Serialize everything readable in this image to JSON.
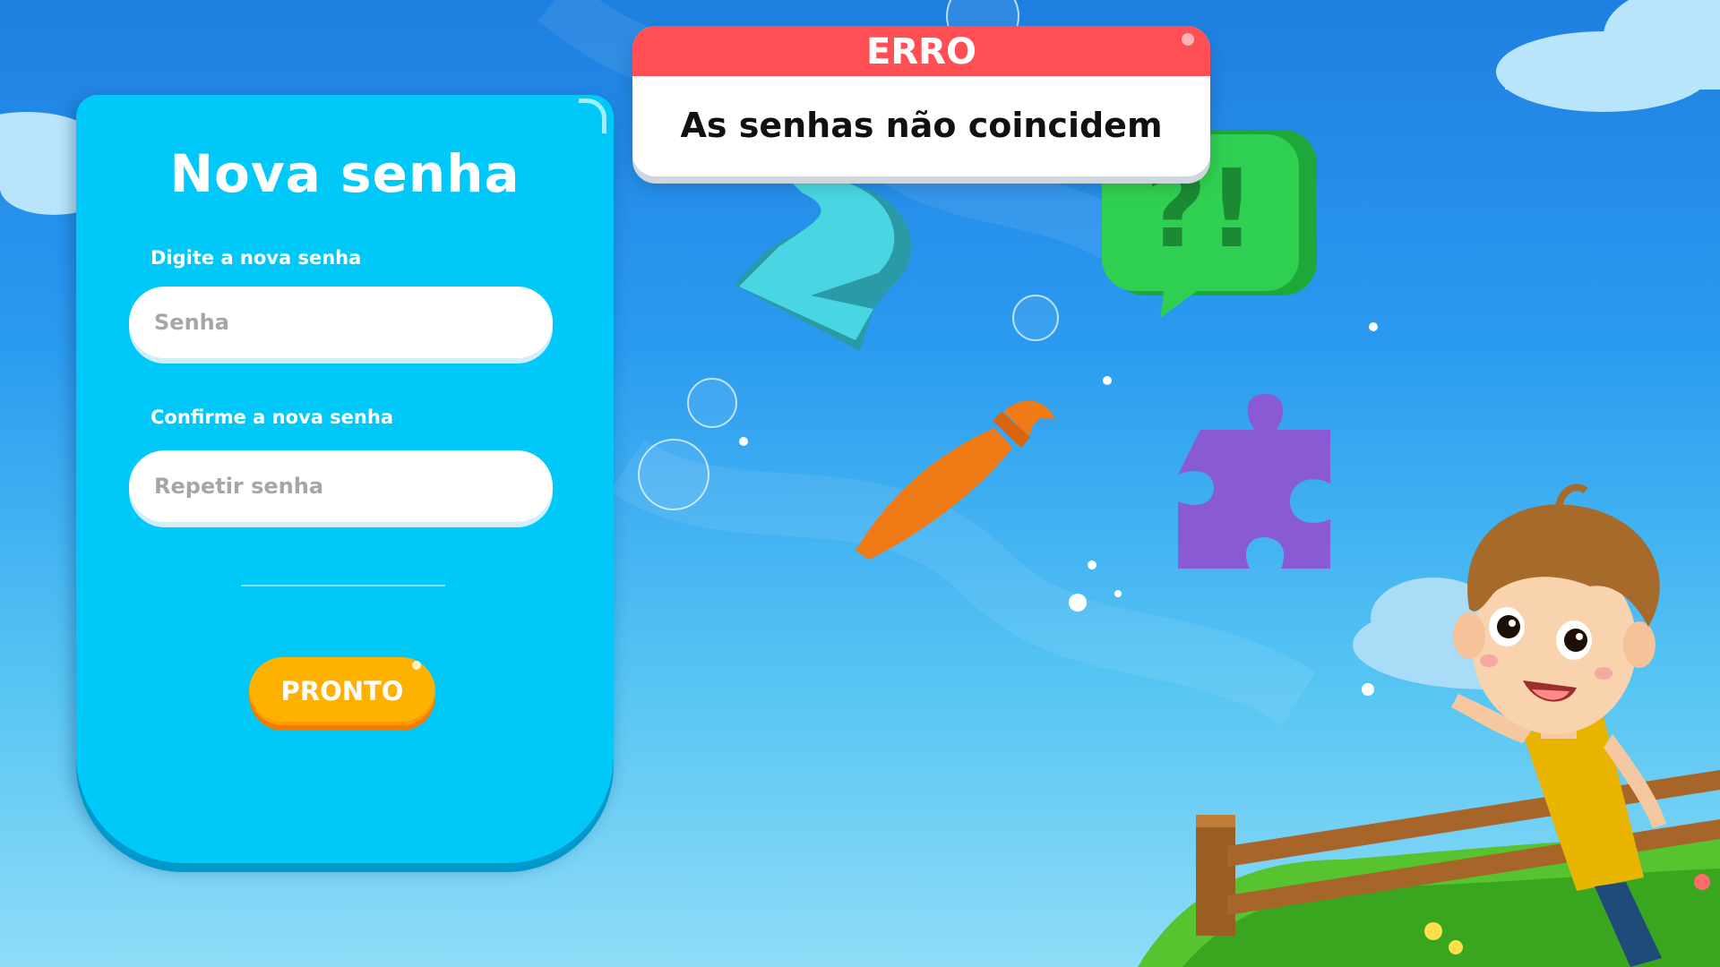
{
  "form": {
    "title": "Nova senha",
    "password_label": "Digite a nova senha",
    "password_placeholder": "Senha",
    "confirm_label": "Confirme a nova senha",
    "confirm_placeholder": "Repetir senha",
    "submit_label": "PRONTO"
  },
  "error_toast": {
    "title": "ERRO",
    "message": "As senhas não coincidem"
  },
  "colors": {
    "panel": "#00c8f8",
    "button": "#ffb100",
    "error_header": "#ff4f55"
  },
  "decor": {
    "floating_question_mark_text": "?!",
    "number_text": "2"
  }
}
